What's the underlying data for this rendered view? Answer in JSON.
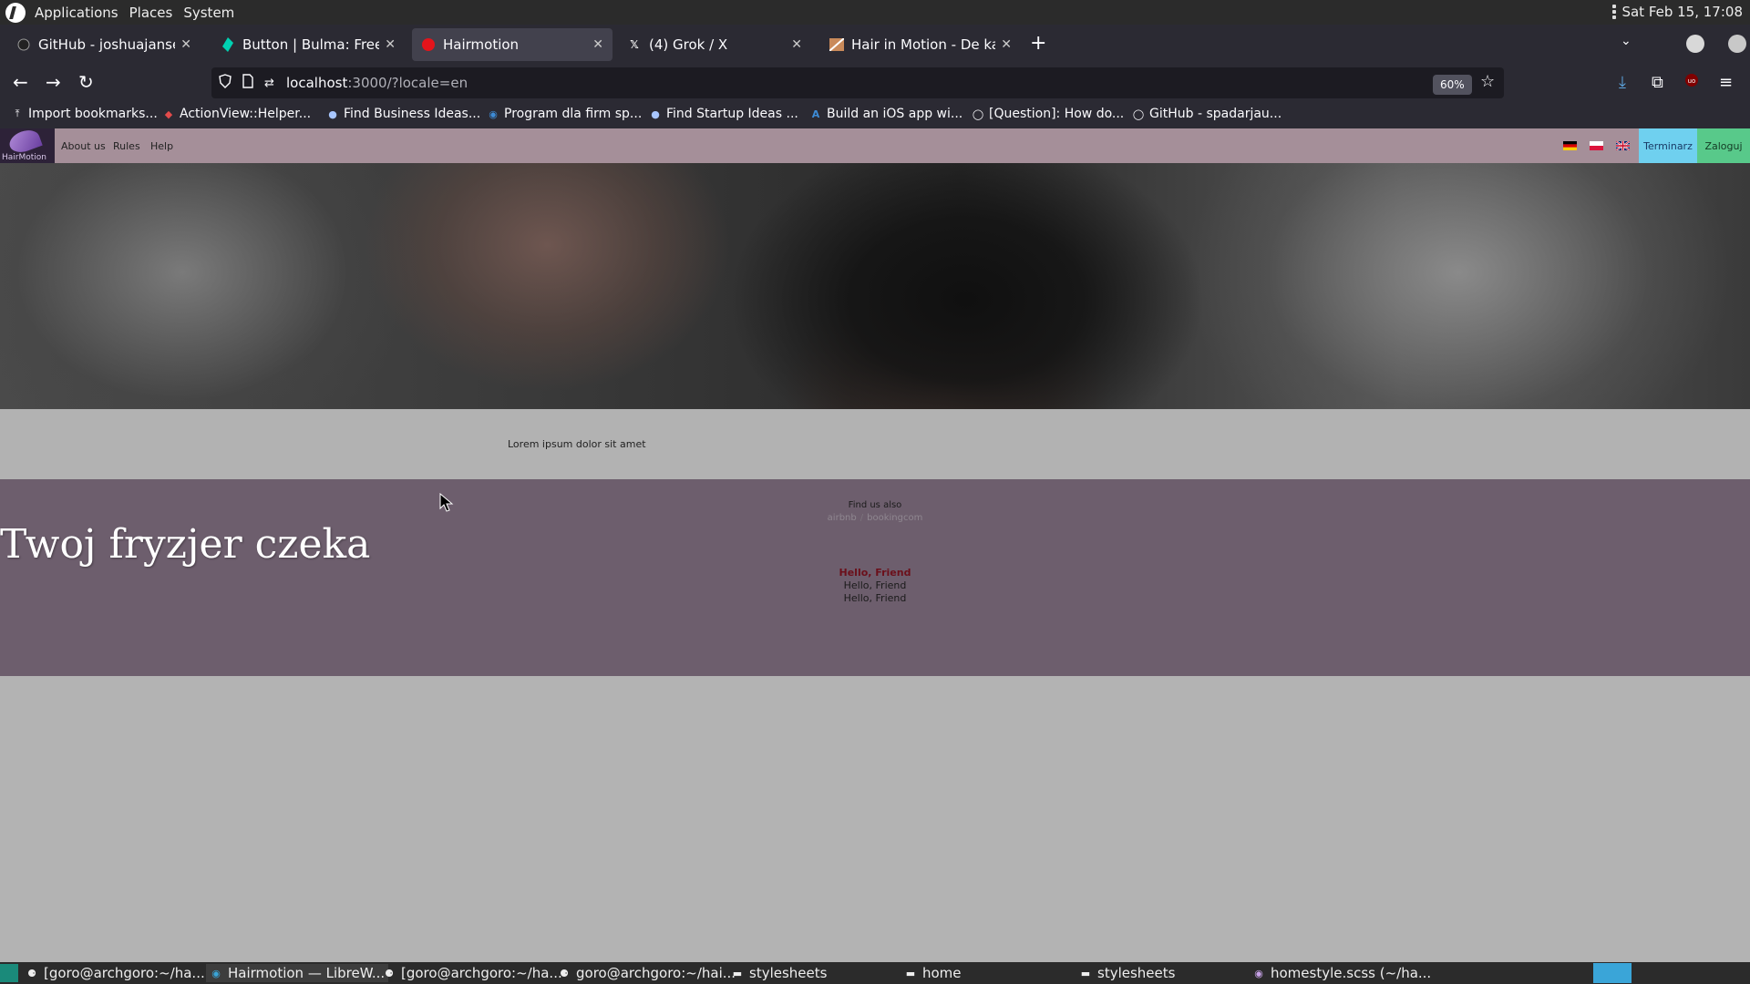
{
  "top_panel": {
    "menu": [
      "Applications",
      "Places",
      "System"
    ],
    "clock": "Sat Feb 15, 17:08"
  },
  "browser": {
    "tabs": [
      {
        "title": "GitHub - joshuajansen/b",
        "icon": "github-icon",
        "active": false
      },
      {
        "title": "Button | Bulma: Free, op",
        "icon": "bulma-icon",
        "active": false
      },
      {
        "title": "Hairmotion",
        "icon": "red-dot-icon",
        "active": true
      },
      {
        "title": "(4) Grok / X",
        "icon": "x-icon",
        "active": false
      },
      {
        "title": "Hair in Motion - De kaps",
        "icon": "hair-icon",
        "active": false
      }
    ],
    "url_host": "localhost",
    "url_rest": ":3000/?locale=en",
    "zoom": "60%",
    "bookmarks": [
      {
        "label": "Import bookmarks...",
        "icon": "import-icon"
      },
      {
        "label": "ActionView::Helper...",
        "icon": "ruby-icon"
      },
      {
        "label": "Find Business Ideas...",
        "icon": "pin-icon"
      },
      {
        "label": "Program dla firm sp...",
        "icon": "program-icon"
      },
      {
        "label": "Find Startup Ideas ...",
        "icon": "pin-icon"
      },
      {
        "label": "Build an iOS app wi...",
        "icon": "a-icon"
      },
      {
        "label": "[Question]: How do...",
        "icon": "github-icon"
      },
      {
        "label": "GitHub - spadarjau...",
        "icon": "github-icon"
      }
    ]
  },
  "site": {
    "logo_text": "HairMotion",
    "nav_links": [
      "About us",
      "Rules",
      "Help"
    ],
    "flags": [
      "german-flag-icon",
      "polish-flag-icon",
      "uk-flag-icon"
    ],
    "terminarz": "Terminarz",
    "zaloguj": "Zaloguj",
    "lorem": "Lorem ipsum dolor sit amet",
    "headline": "Twoj fryzjer czeka",
    "find_us": "Find us also",
    "find_links": [
      "airbnb",
      "bookingcom"
    ],
    "find_sep": "/",
    "hellos": [
      "Hello, Friend",
      "Hello, Friend",
      "Hello, Friend"
    ]
  },
  "taskbar": {
    "items": [
      {
        "label": "[goro@archgoro:~/ha...",
        "icon": "terminal-icon"
      },
      {
        "label": "Hairmotion — LibreW...",
        "icon": "browser-icon"
      },
      {
        "label": "[goro@archgoro:~/ha...",
        "icon": "terminal-icon"
      },
      {
        "label": "goro@archgoro:~/hai...",
        "icon": "terminal-icon"
      },
      {
        "label": "stylesheets",
        "icon": "folder-icon"
      },
      {
        "label": "home",
        "icon": "folder-icon"
      },
      {
        "label": "stylesheets",
        "icon": "folder-icon"
      },
      {
        "label": "homestyle.scss (~/ha...",
        "icon": "editor-icon"
      }
    ]
  }
}
